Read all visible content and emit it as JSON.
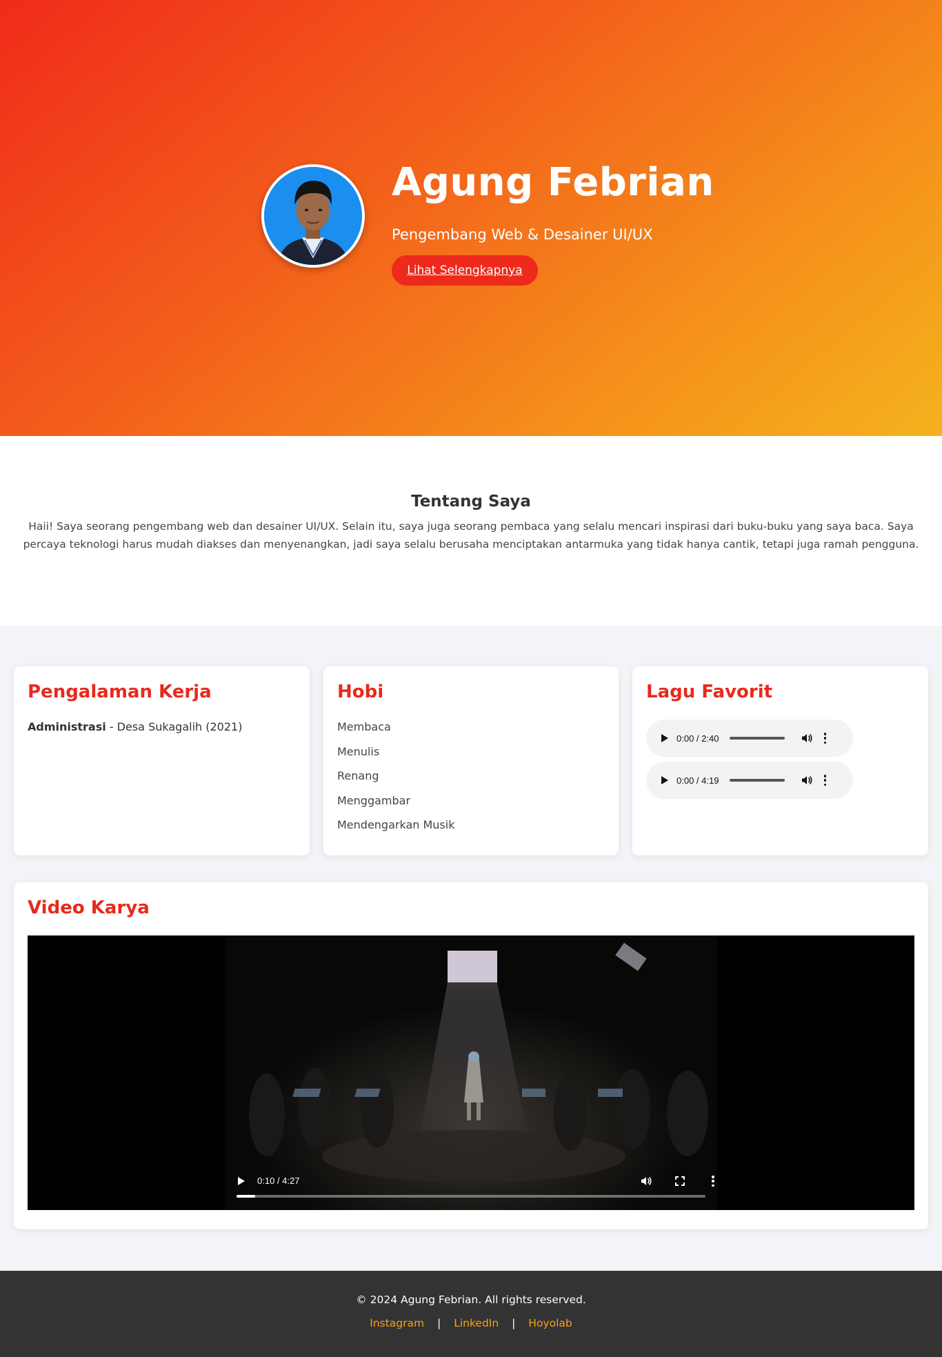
{
  "hero": {
    "name": "Agung Febrian",
    "subtitle": "Pengembang Web & Desainer UI/UX",
    "button_label": "Lihat Selengkapnya"
  },
  "about": {
    "title": "Tentang Saya",
    "text": "Haii! Saya seorang pengembang web dan desainer UI/UX. Selain itu, saya juga seorang pembaca yang selalu mencari inspirasi dari buku-buku yang saya baca. Saya percaya teknologi harus mudah diakses dan menyenangkan, jadi saya selalu berusaha menciptakan antarmuka yang tidak hanya cantik, tetapi juga ramah pengguna."
  },
  "experience": {
    "title": "Pengalaman Kerja",
    "items": [
      {
        "role": "Administrasi",
        "detail": " - Desa Sukagalih (2021)"
      }
    ]
  },
  "hobbies": {
    "title": "Hobi",
    "items": [
      "Membaca",
      "Menulis",
      "Renang",
      "Menggambar",
      "Mendengarkan Musik"
    ]
  },
  "songs": {
    "title": "Lagu Favorit",
    "players": [
      {
        "time": "0:00 / 2:40"
      },
      {
        "time": "0:00 / 4:19"
      }
    ]
  },
  "video": {
    "title": "Video Karya",
    "time": "0:10 / 4:27",
    "progress": 0.04
  },
  "footer": {
    "copyright": "© 2024 Agung Febrian. All rights reserved.",
    "links": [
      "Instagram",
      "LinkedIn",
      "Hoyolab"
    ],
    "separator": "|"
  },
  "colors": {
    "accent": "#e8291c",
    "link": "#f7a21b",
    "footer_bg": "#333333"
  }
}
